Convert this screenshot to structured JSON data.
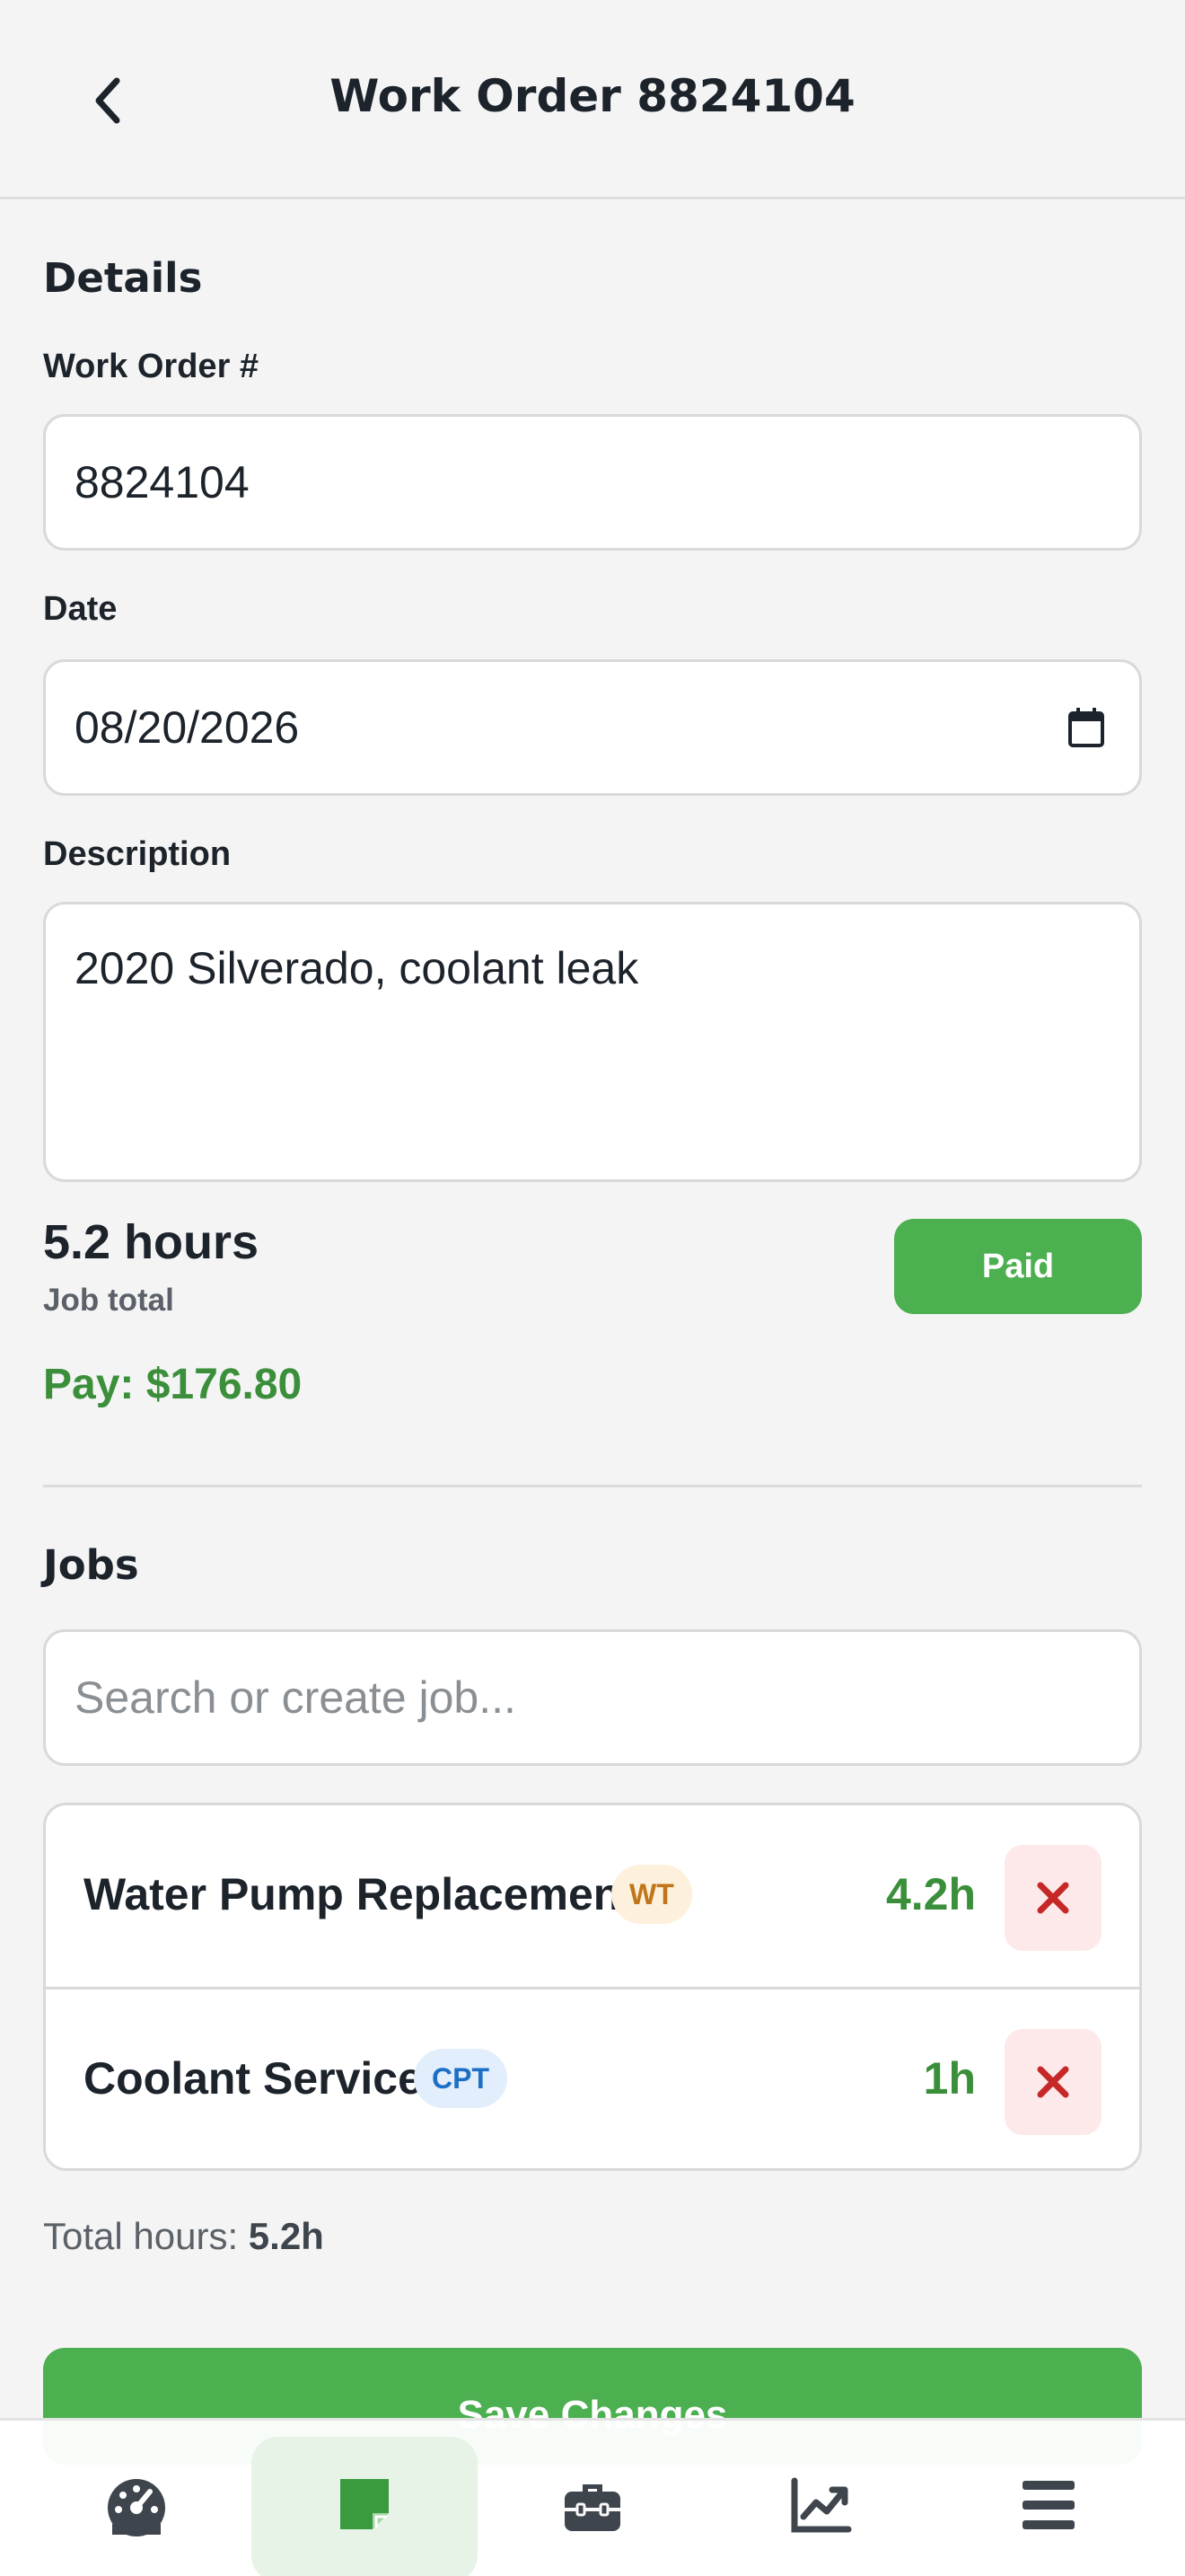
{
  "header": {
    "title": "Work Order 8824104"
  },
  "details": {
    "section_title": "Details",
    "work_order_label": "Work Order #",
    "work_order_value": "8824104",
    "date_label": "Date",
    "date_value": "08/20/2026",
    "description_label": "Description",
    "description_value": "2020 Silverado, coolant leak"
  },
  "summary": {
    "hours": "5.2 hours",
    "job_total_label": "Job total",
    "pay": "Pay: $176.80",
    "paid_button": "Paid"
  },
  "jobs": {
    "section_title": "Jobs",
    "search_placeholder": "Search or create job...",
    "items": [
      {
        "name": "Water Pump Replacement",
        "badge": "WT",
        "hours": "4.2h"
      },
      {
        "name": "Coolant Service",
        "badge": "CPT",
        "hours": "1h"
      }
    ],
    "total_label": "Total hours:",
    "total_value": "5.2h"
  },
  "save_button": "Save Changes",
  "nav": {
    "items": [
      "dashboard-icon",
      "work-order-icon",
      "jobs-icon",
      "reports-icon",
      "menu-icon"
    ],
    "active": "work-order-icon"
  },
  "colors": {
    "accent_green": "#4caf50",
    "pay_green": "#3b8f3b",
    "danger_red": "#c62828",
    "badge_wt": "#c07517",
    "badge_cpt": "#1d6fc6"
  }
}
